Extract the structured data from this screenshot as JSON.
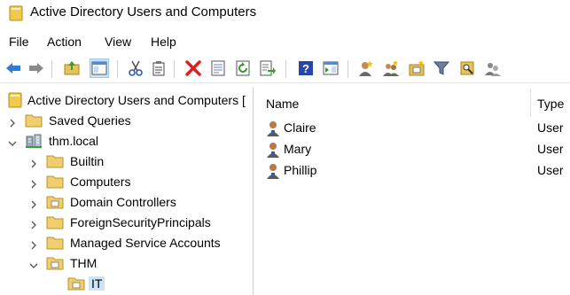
{
  "window": {
    "title": "Active Directory Users and Computers"
  },
  "menu": [
    "File",
    "Action",
    "View",
    "Help"
  ],
  "toolbar": {
    "icons": [
      "back-arrow-icon",
      "forward-arrow-icon",
      "up-folder-icon",
      "show-console-tree-icon",
      "cut-icon",
      "copy-icon",
      "delete-icon",
      "properties-icon",
      "refresh-icon",
      "export-list-icon",
      "help-icon",
      "show-action-pane-icon",
      "new-user-icon",
      "new-group-icon",
      "new-ou-icon",
      "filter-icon",
      "find-icon",
      "delegate-control-icon"
    ]
  },
  "tree": [
    {
      "label": "Active Directory Users and Computers [",
      "level": 0,
      "chevron": "none",
      "icon": "aduc-icon"
    },
    {
      "label": "Saved Queries",
      "level": 1,
      "chevron": "right",
      "icon": "folder-icon"
    },
    {
      "label": "thm.local",
      "level": 1,
      "chevron": "down",
      "icon": "domain-icon"
    },
    {
      "label": "Builtin",
      "level": 2,
      "chevron": "right",
      "icon": "folder-icon"
    },
    {
      "label": "Computers",
      "level": 2,
      "chevron": "right",
      "icon": "folder-icon"
    },
    {
      "label": "Domain Controllers",
      "level": 2,
      "chevron": "right",
      "icon": "ou-folder-icon"
    },
    {
      "label": "ForeignSecurityPrincipals",
      "level": 2,
      "chevron": "right",
      "icon": "folder-icon"
    },
    {
      "label": "Managed Service Accounts",
      "level": 2,
      "chevron": "right",
      "icon": "folder-icon"
    },
    {
      "label": "THM",
      "level": 2,
      "chevron": "down",
      "icon": "ou-folder-icon"
    },
    {
      "label": "IT",
      "level": 3,
      "chevron": "none",
      "icon": "ou-folder-icon",
      "selected": true
    }
  ],
  "list": {
    "columns": [
      "Name",
      "Type"
    ],
    "rows": [
      {
        "name": "Claire",
        "type": "User"
      },
      {
        "name": "Mary",
        "type": "User"
      },
      {
        "name": "Phillip",
        "type": "User"
      }
    ]
  }
}
